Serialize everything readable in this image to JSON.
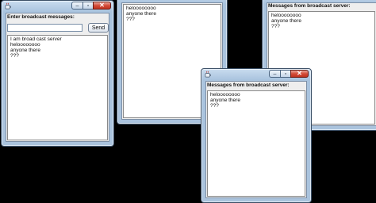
{
  "server_window": {
    "prompt_label": "Enter broadcast messages:",
    "message_input": "",
    "send_label": "Send",
    "log": [
      "I am broad cast server",
      "heloooooooo",
      "anyone there",
      "???"
    ]
  },
  "client_window_1": {
    "messages": [
      "heloooooooo",
      "anyone there",
      "???"
    ]
  },
  "client_window_2": {
    "header": "Messages from broadcast server:",
    "messages": [
      "heloooooooo",
      "anyone there",
      "???"
    ]
  },
  "client_window_3": {
    "header": "Messages from broadcast server:",
    "messages": [
      "heloooooooo",
      "anyone there",
      "???"
    ]
  },
  "icons": [
    "java-app-icon",
    "minimize-icon",
    "maximize-icon",
    "close-icon"
  ]
}
